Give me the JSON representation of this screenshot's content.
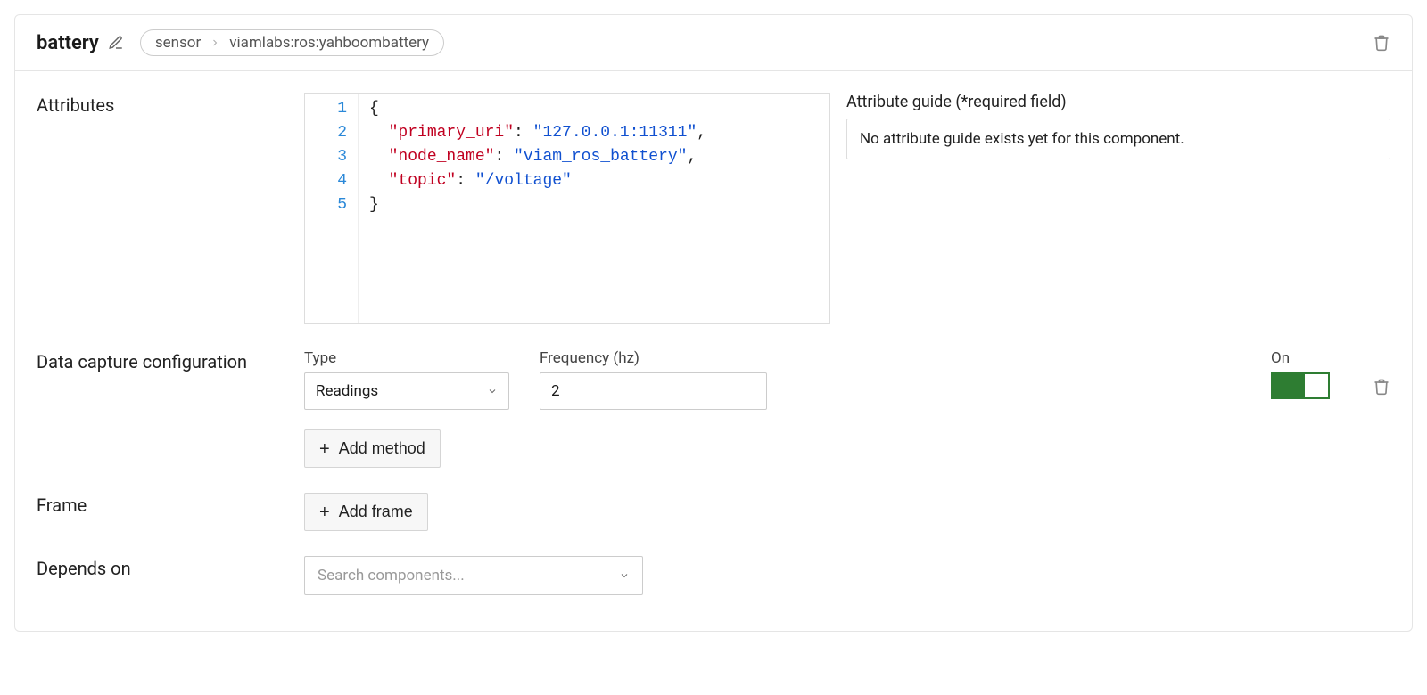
{
  "header": {
    "title": "battery",
    "breadcrumb": {
      "type": "sensor",
      "model": "viamlabs:ros:yahboombattery"
    }
  },
  "attributes": {
    "label": "Attributes",
    "code_lines": [
      {
        "n": 1,
        "raw": "{"
      },
      {
        "n": 2,
        "key": "primary_uri",
        "value": "127.0.0.1:11311",
        "trailing_comma": true
      },
      {
        "n": 3,
        "key": "node_name",
        "value": "viam_ros_battery",
        "trailing_comma": true
      },
      {
        "n": 4,
        "key": "topic",
        "value": "/voltage",
        "trailing_comma": false
      },
      {
        "n": 5,
        "raw": "}"
      }
    ],
    "guide_label": "Attribute guide (*required field)",
    "guide_text": "No attribute guide exists yet for this component."
  },
  "data_capture": {
    "label": "Data capture configuration",
    "type_label": "Type",
    "type_value": "Readings",
    "freq_label": "Frequency (hz)",
    "freq_value": "2",
    "on_label": "On",
    "add_method_label": "Add method"
  },
  "frame": {
    "label": "Frame",
    "add_frame_label": "Add frame"
  },
  "depends_on": {
    "label": "Depends on",
    "placeholder": "Search components..."
  }
}
